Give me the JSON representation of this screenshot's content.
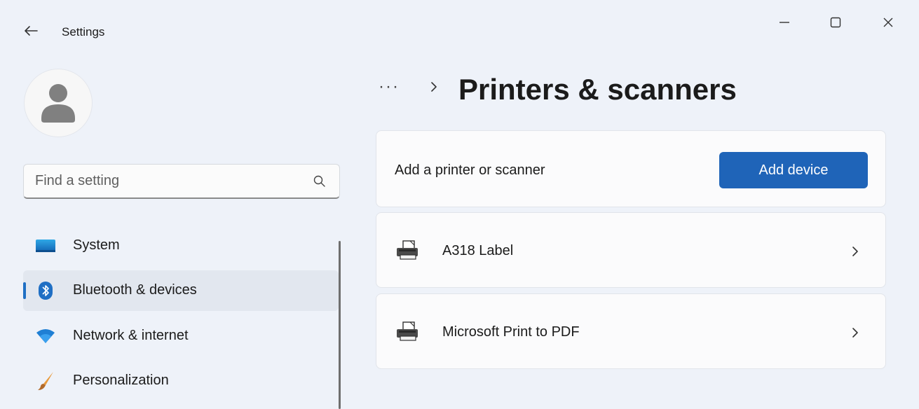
{
  "window": {
    "title": "Settings",
    "controls": {
      "minimize": "minimize",
      "maximize": "maximize",
      "close": "close"
    }
  },
  "search": {
    "placeholder": "Find a setting",
    "value": ""
  },
  "sidebar": {
    "items": [
      {
        "label": "System",
        "icon": "system-monitor-icon",
        "selected": false
      },
      {
        "label": "Bluetooth & devices",
        "icon": "bluetooth-icon",
        "selected": true
      },
      {
        "label": "Network & internet",
        "icon": "wifi-icon",
        "selected": false
      },
      {
        "label": "Personalization",
        "icon": "paintbrush-icon",
        "selected": false
      }
    ]
  },
  "breadcrumb": {
    "more": "···",
    "title": "Printers & scanners"
  },
  "add_card": {
    "label": "Add a printer or scanner",
    "button_label": "Add device"
  },
  "printers": [
    {
      "name": "A318 Label",
      "icon": "printer-icon"
    },
    {
      "name": "Microsoft Print to PDF",
      "icon": "printer-icon"
    }
  ],
  "colors": {
    "accent": "#1f64b8",
    "background": "#eef2f9",
    "card": "#fbfbfc",
    "selected": "#e2e7ef"
  }
}
